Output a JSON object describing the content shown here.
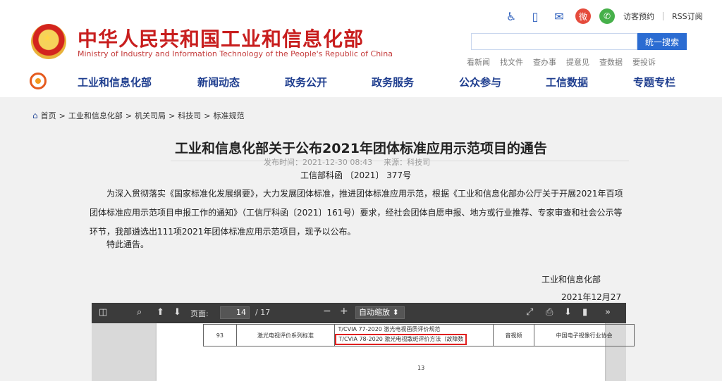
{
  "header": {
    "title": "中华人民共和国工业和信息化部",
    "subtitle": "Ministry of Industry and Information Technology of the People's Republic of China",
    "visitor_link": "访客预约",
    "rss_link": "RSS订阅",
    "search_button": "统一搜索",
    "search_placeholder": "",
    "quick_links": [
      "看新闻",
      "找文件",
      "查办事",
      "提意见",
      "查数据",
      "要投诉"
    ]
  },
  "nav": {
    "items": [
      "工业和信息化部",
      "新闻动态",
      "政务公开",
      "政务服务",
      "公众参与",
      "工信数据",
      "专题专栏"
    ]
  },
  "breadcrumb": [
    "首页",
    "工业和信息化部",
    "机关司局",
    "科技司",
    "标准规范"
  ],
  "article": {
    "title": "工业和信息化部关于公布2021年团体标准应用示范项目的通告",
    "publish_time": "发布时间：2021-12-30 08:43",
    "source": "来源：科技司",
    "doc_number": "工信部科函 〔2021〕 377号",
    "paragraph1": "为深入贯彻落实《国家标准化发展纲要》，大力发展团体标准，推进团体标准应用示范，根据《工业和信息化部办公厅关于开展2021年百项团体标准应用示范项目申报工作的通知》（工信厅科函〔2021〕161号）要求，经社会团体自愿申报、地方或行业推荐、专家审查和社会公示等环节，我部遴选出111项2021年团体标准应用示范项目，现予以公布。",
    "paragraph2": "特此通告。",
    "sign_org": "工业和信息化部",
    "sign_date": "2021年12月27日"
  },
  "pdf_viewer": {
    "page_label": "页面:",
    "current_page": "14",
    "total_pages": "/ 17",
    "zoom": "自动缩放",
    "row": {
      "number": "93",
      "name": "激光电视评价系列标准",
      "standard1": "T/CVIA 77-2020 激光电视画质评价规范",
      "standard2": "T/CVIA 78-2020 激光电视散斑评价方法（故障数",
      "category": "音视频",
      "org": "中国电子视像行业协会"
    },
    "page_number": "13"
  }
}
